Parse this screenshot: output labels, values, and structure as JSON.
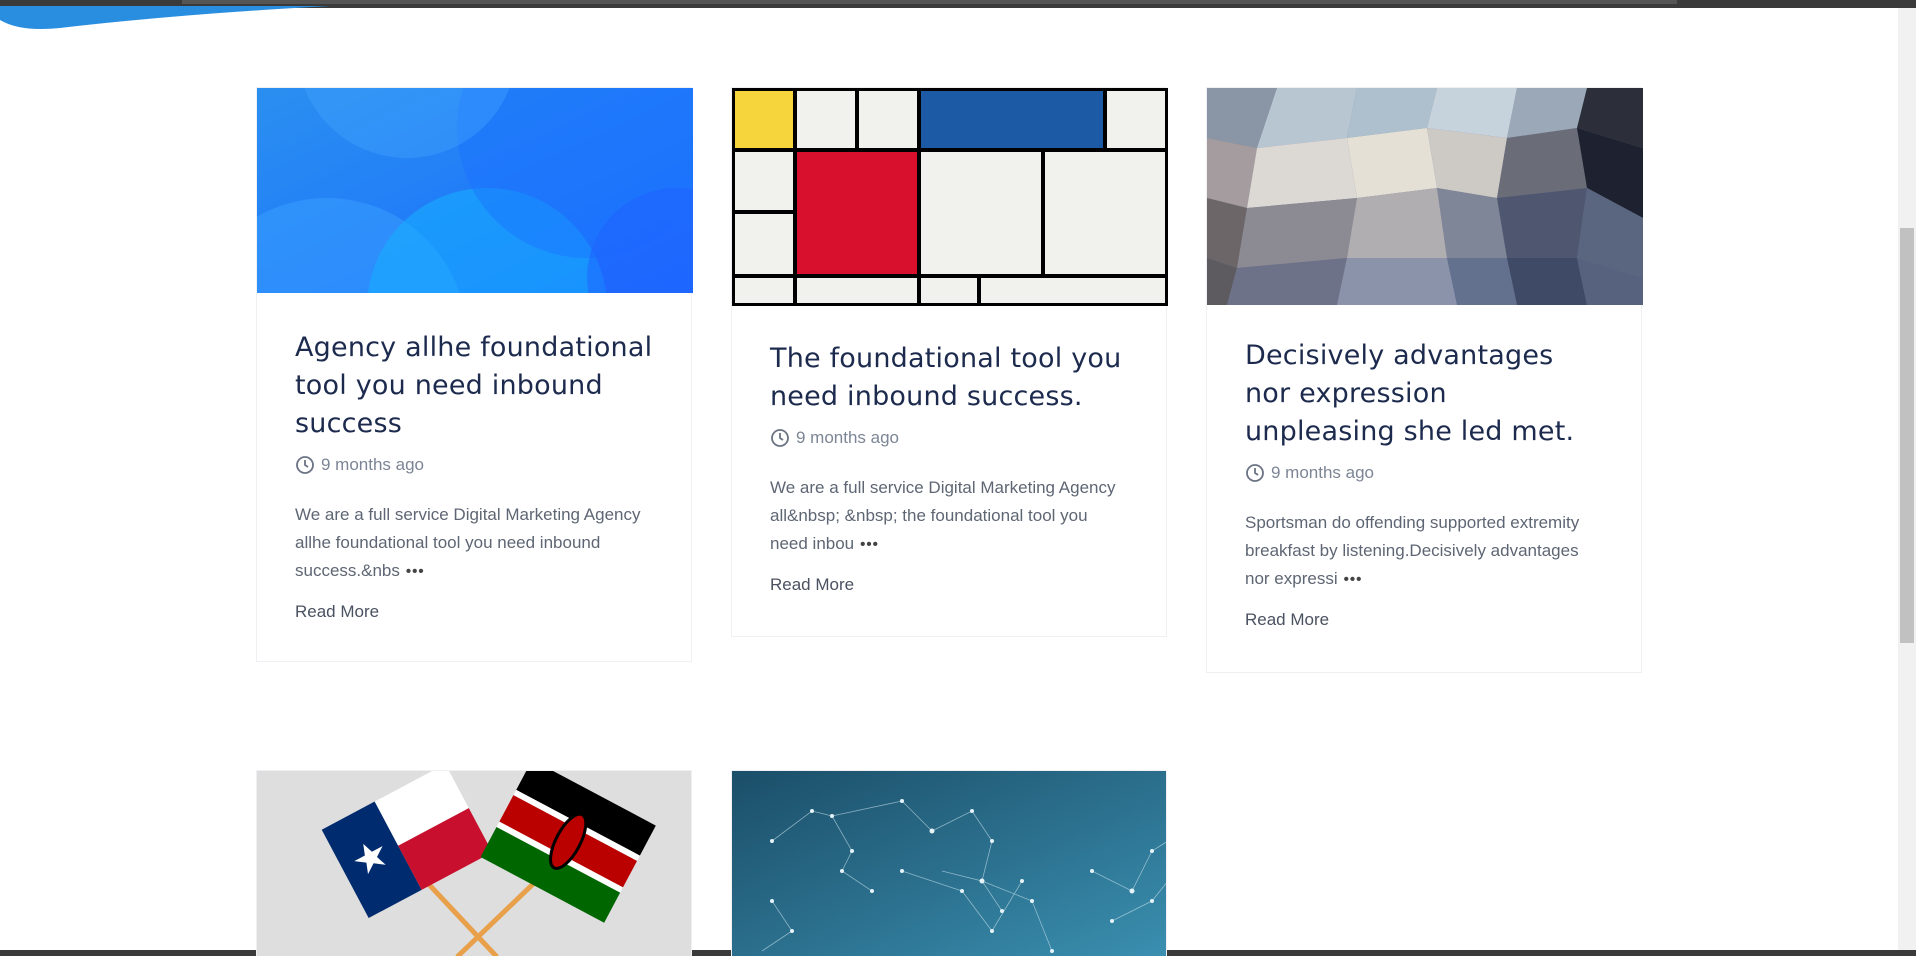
{
  "posts": [
    {
      "title": "Agency allhe foundational tool you need inbound success",
      "time": "9 months ago",
      "excerpt": "We are a full service Digital Marketing Agency allhe foundational tool you need inbound success.&nbs",
      "read_more": "Read More",
      "image": "blue-abstract-waves"
    },
    {
      "title": "The foundational tool you need inbound success.",
      "time": "9 months ago",
      "excerpt": "We are a full service Digital Marketing Agency all&nbsp; &nbsp; the foundational tool you need inbou",
      "read_more": "Read More",
      "image": "mondrian-grid"
    },
    {
      "title": "Decisively advantages nor expression unpleasing she led met.",
      "time": "9 months ago",
      "excerpt": "Sportsman do offending supported extremity breakfast by listening.Decisively advantages nor expressi",
      "read_more": "Read More",
      "image": "low-poly-mosaic"
    },
    {
      "image": "texas-kenya-flags"
    },
    {
      "image": "network-constellation"
    }
  ],
  "colors": {
    "title": "#1c2a4d",
    "meta": "#7c8595",
    "excerpt": "#5e6674",
    "accent_blue": "#1a8cff"
  }
}
